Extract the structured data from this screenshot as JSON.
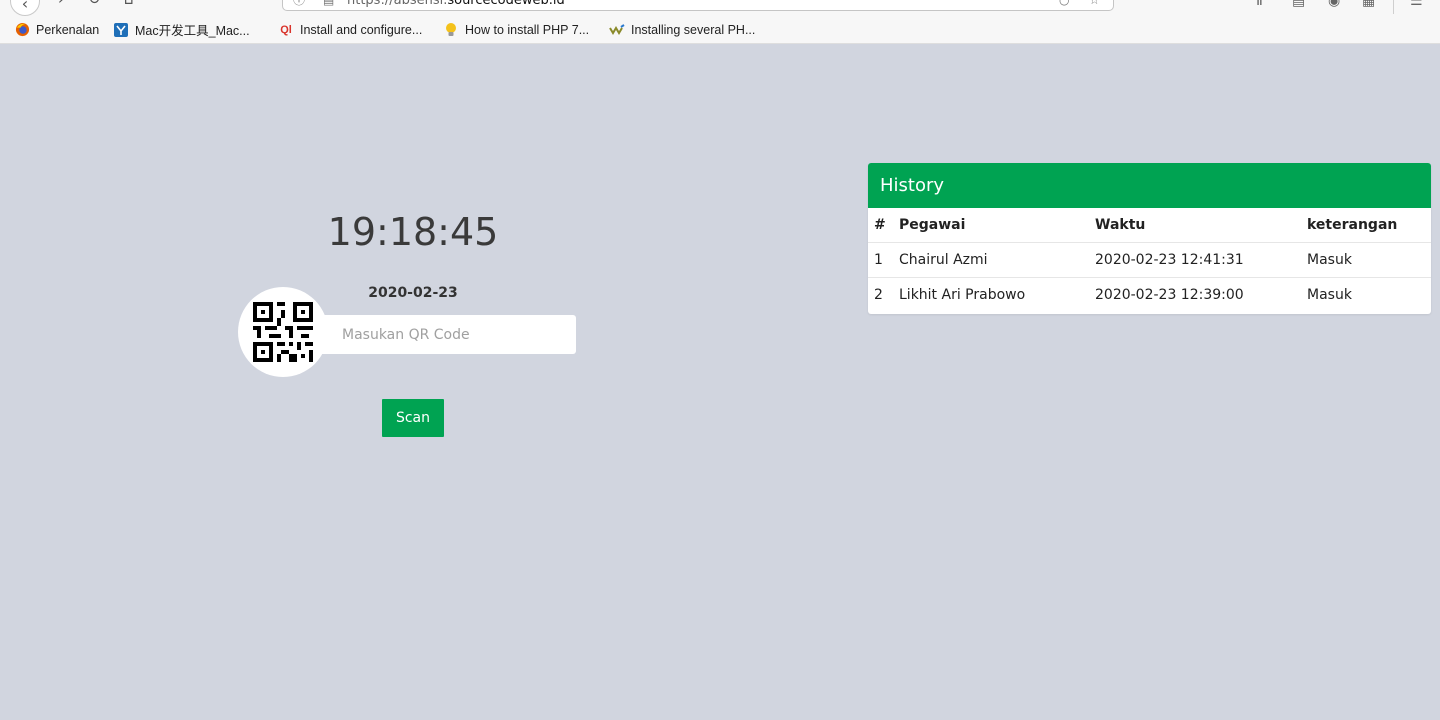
{
  "browser": {
    "url_prefix": "https://absensi.",
    "url_domain": "sourcecodeweb.id",
    "bookmarks": [
      {
        "label": "Perkenalan",
        "icon": "firefox-icon"
      },
      {
        "label": "Mac开发工具_Mac...",
        "icon": "mac-tools-icon"
      },
      {
        "label": "Install and configure...",
        "icon": "ql-icon"
      },
      {
        "label": "How to install PHP 7...",
        "icon": "lightbulb-icon"
      },
      {
        "label": "Installing several PH...",
        "icon": "wave-icon"
      }
    ]
  },
  "main": {
    "clock": "19:18:45",
    "date": "2020-02-23",
    "qr_input": {
      "placeholder": "Masukan QR Code",
      "value": ""
    },
    "scan_label": "Scan"
  },
  "history": {
    "title": "History",
    "columns": [
      "#",
      "Pegawai",
      "Waktu",
      "keterangan"
    ],
    "rows": [
      {
        "no": "1",
        "pegawai": "Chairul Azmi",
        "waktu": "2020-02-23 12:41:31",
        "keterangan": "Masuk"
      },
      {
        "no": "2",
        "pegawai": "Likhit Ari Prabowo",
        "waktu": "2020-02-23 12:39:00",
        "keterangan": "Masuk"
      }
    ]
  },
  "colors": {
    "accent": "#00a352",
    "background": "#d1d5df"
  }
}
